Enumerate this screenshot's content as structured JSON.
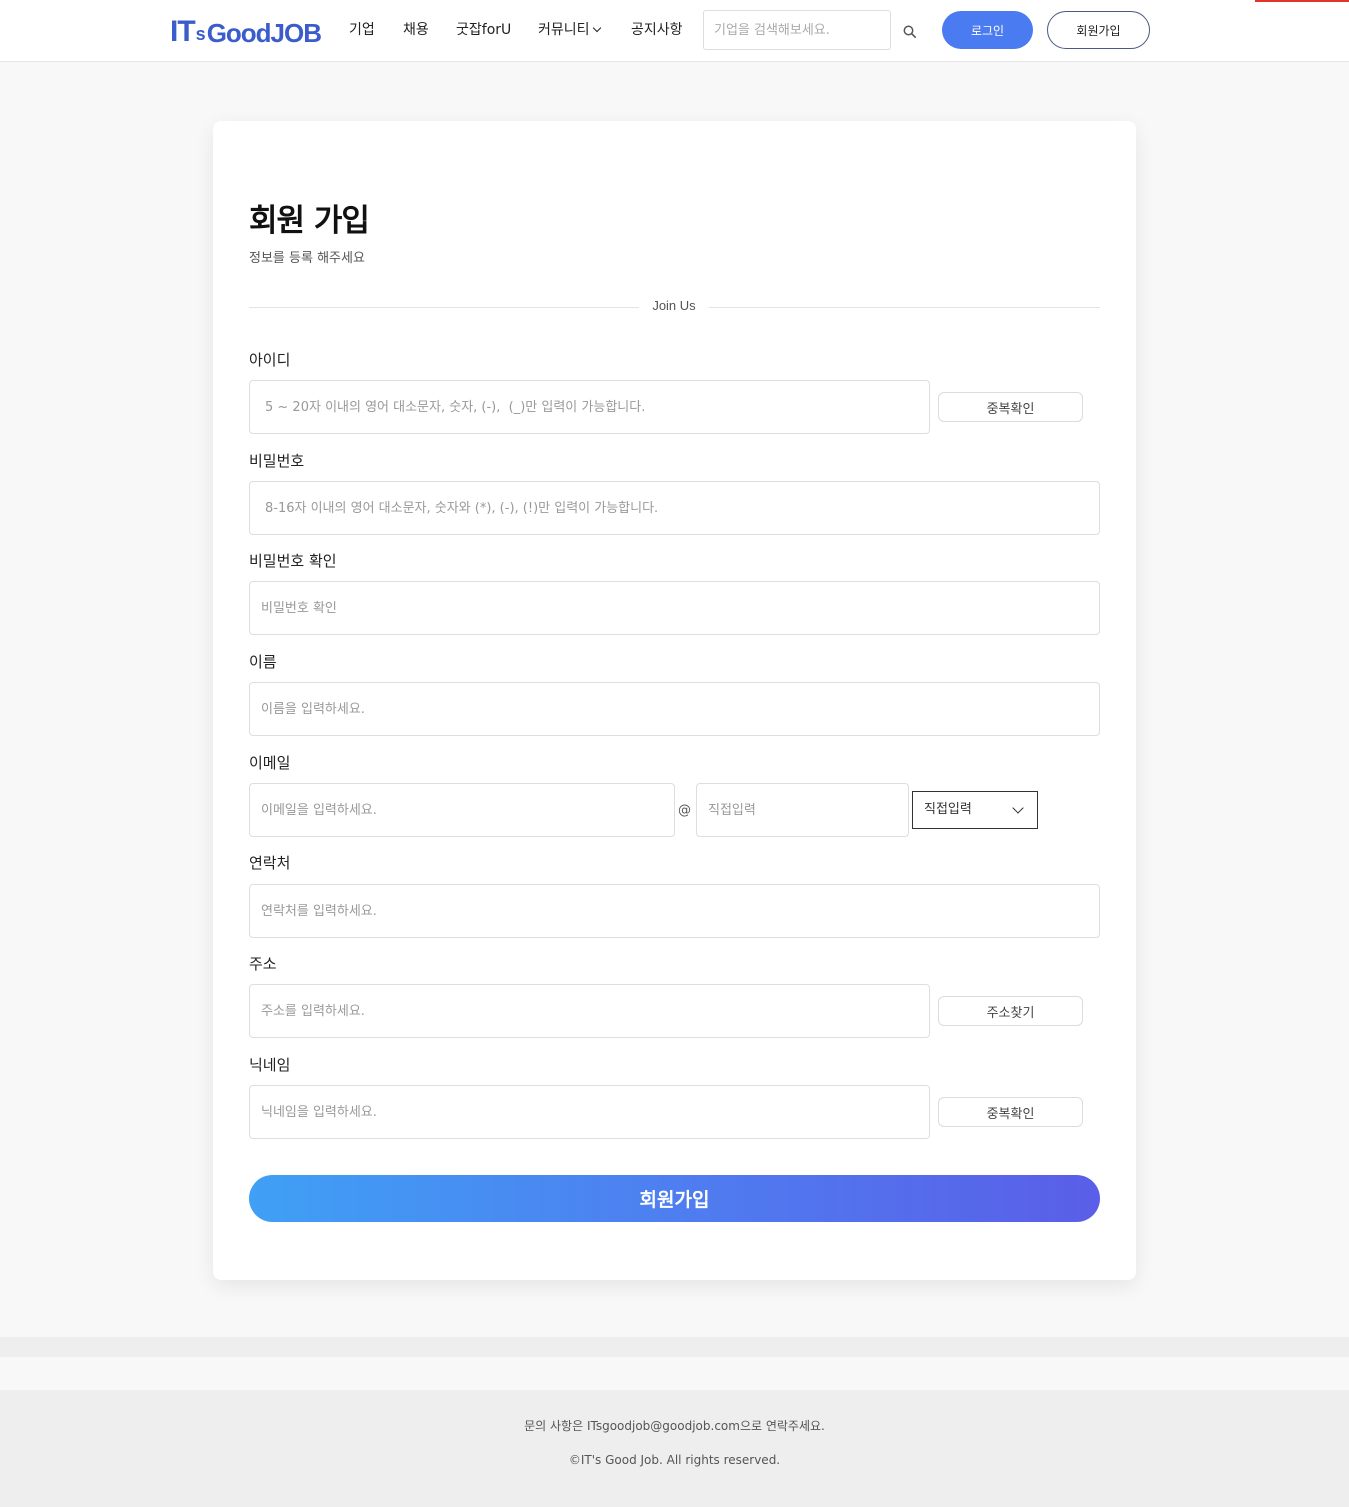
{
  "header": {
    "logo": {
      "part1": "IT",
      "part2": "s",
      "part3": "GoodJOB"
    },
    "nav": [
      {
        "label": "기업"
      },
      {
        "label": "채용"
      },
      {
        "label": "굿잡forU"
      },
      {
        "label": "커뮤니티"
      },
      {
        "label": "공지사항"
      }
    ],
    "search_placeholder": "기업을 검색해보세요.",
    "login_label": "로그인",
    "join_label": "회원가입"
  },
  "form": {
    "title": "회원 가입",
    "subtitle": "정보를 등록 해주세요",
    "divider_label": "Join Us",
    "id": {
      "label": "아이디",
      "placeholder": "5 ~ 20자 이내의 영어 대소문자, 숫자, (-),  (_)만 입력이 가능합니다.",
      "button": "중복확인"
    },
    "password": {
      "label": "비밀번호",
      "placeholder": "8-16자 이내의 영어 대소문자, 숫자와 (*), (-), (!)만 입력이 가능합니다."
    },
    "password_confirm": {
      "label": "비밀번호 확인",
      "placeholder": "비밀번호 확인"
    },
    "name": {
      "label": "이름",
      "placeholder": "이름을 입력하세요."
    },
    "email": {
      "label": "이메일",
      "placeholder": "이메일을 입력하세요.",
      "at": "@",
      "domain_placeholder": "직접입력",
      "select_value": "직접입력"
    },
    "phone": {
      "label": "연락처",
      "placeholder": "연락처를 입력하세요."
    },
    "address": {
      "label": "주소",
      "placeholder": "주소를 입력하세요.",
      "button": "주소찾기"
    },
    "nickname": {
      "label": "닉네임",
      "placeholder": "닉네임을 입력하세요.",
      "button": "중복확인"
    },
    "submit": "회원가입"
  },
  "footer": {
    "contact": "문의 사항은 ITsgoodjob@goodjob.com으로 연락주세요.",
    "copyright": "©IT's Good Job. All rights reserved."
  },
  "colors": {
    "accent": "#4a7bf0",
    "gradient_start": "#3fa0f5",
    "gradient_end": "#5a5ee8",
    "logo": "#3a5ccc"
  }
}
